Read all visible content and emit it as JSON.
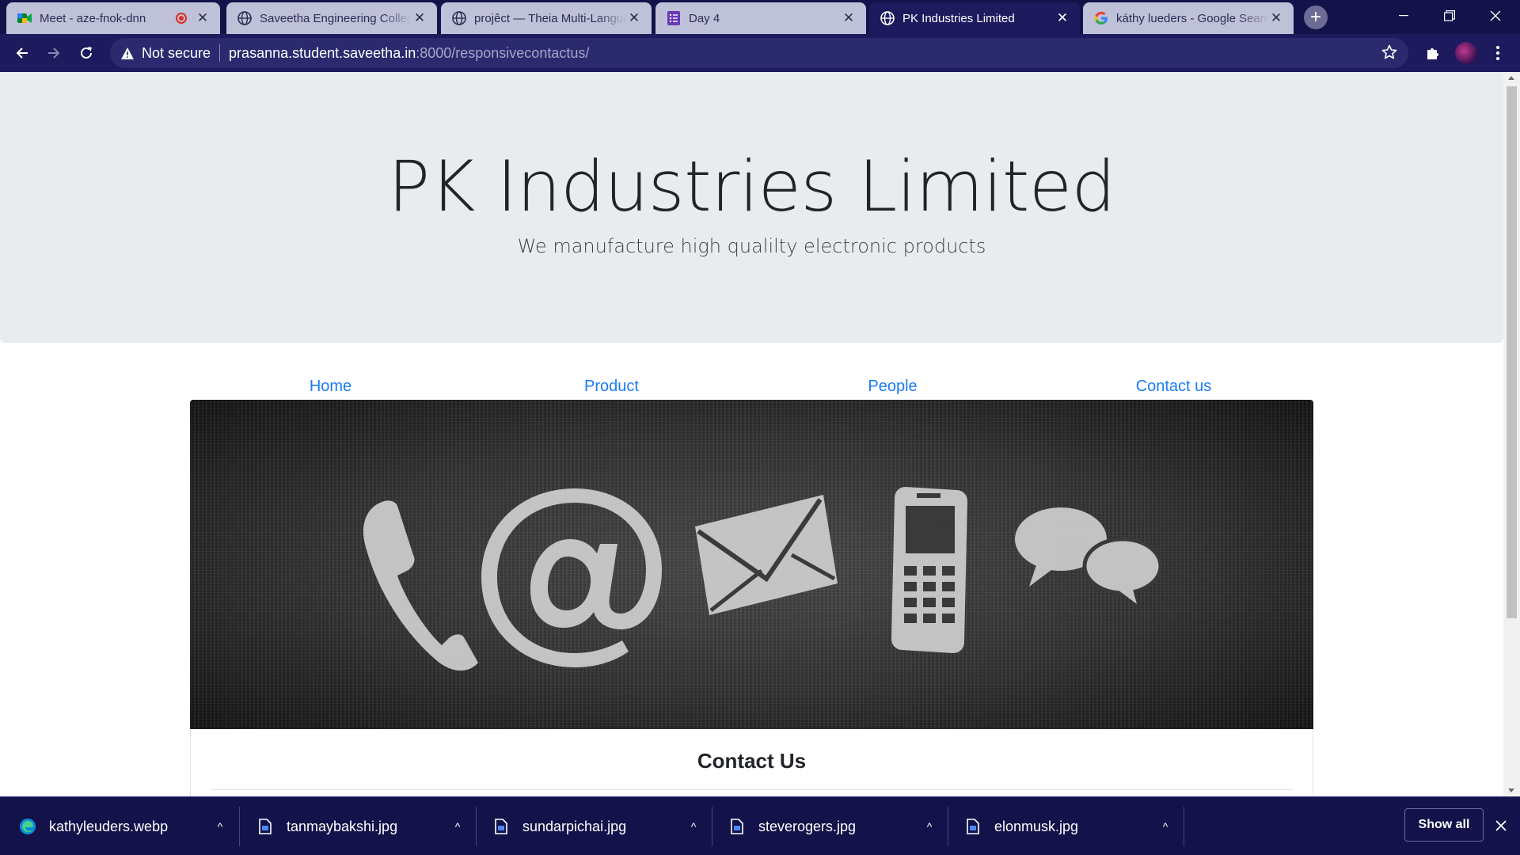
{
  "tabs": [
    {
      "title": "Meet - aze-fnok-dnn",
      "icon": "google-meet-icon",
      "recording": true,
      "active": false
    },
    {
      "title": "Saveetha Engineering College",
      "icon": "globe-icon",
      "active": false
    },
    {
      "title": "projêct — Theia Multi-Language",
      "icon": "globe-icon",
      "active": false
    },
    {
      "title": "Day 4",
      "icon": "forms-icon",
      "active": false
    },
    {
      "title": "PK Industries Limited",
      "icon": "globe-icon",
      "active": true
    },
    {
      "title": "káthy lueders - Google Search",
      "icon": "google-icon",
      "active": false
    }
  ],
  "address_bar": {
    "security_label": "Not secure",
    "host": "prasanna.student.saveetha.in",
    "path": ":8000/responsivecontactus/"
  },
  "page": {
    "title": "PK Industries Limited",
    "tagline": "We manufacture high qualilty electronic products",
    "nav": [
      "Home",
      "Product",
      "People",
      "Contact us"
    ],
    "section_title": "Contact Us"
  },
  "downloads": [
    {
      "name": "kathyleuders.webp",
      "icon": "edge-icon"
    },
    {
      "name": "tanmaybakshi.jpg",
      "icon": "file-icon"
    },
    {
      "name": "sundarpichai.jpg",
      "icon": "file-icon"
    },
    {
      "name": "steverogers.jpg",
      "icon": "file-icon"
    },
    {
      "name": "elonmusk.jpg",
      "icon": "file-icon"
    }
  ],
  "show_all_label": "Show all",
  "colors": {
    "chrome_dark": "#14124a",
    "toolbar": "#1d1a5e",
    "link": "#1b7cf2",
    "jumbotron": "#e9ecef"
  }
}
